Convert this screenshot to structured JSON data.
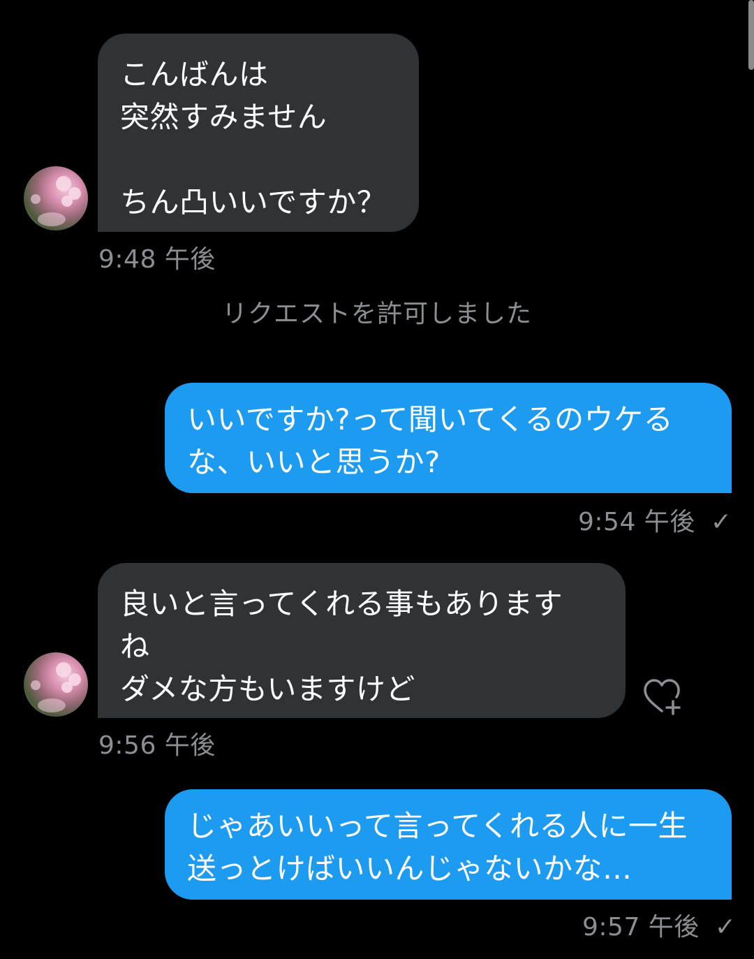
{
  "system_message": "リクエストを許可しました",
  "messages": [
    {
      "direction": "incoming",
      "text": "こんばんは\n突然すみません\n\nちん凸いいですか？",
      "time": "9:48 午後"
    },
    {
      "direction": "outgoing",
      "text": "いいですか?って聞いてくるのウケる\nな、いいと思うか?",
      "time": "9:54 午後",
      "status_icon": "checkmark-icon",
      "status_glyph": "✓"
    },
    {
      "direction": "incoming",
      "text": "良いと言ってくれる事もあります\nね\nダメな方もいますけど",
      "time": "9:56 午後",
      "action_icon": "heart-plus-icon"
    },
    {
      "direction": "outgoing",
      "text": "じゃあいいって言ってくれる人に一生\n送っとけばいいんじゃないかな…",
      "time": "9:57 午後",
      "status_icon": "checkmark-icon",
      "status_glyph": "✓"
    }
  ],
  "colors": {
    "background": "#000000",
    "incoming_bubble": "#2f3336",
    "outgoing_bubble": "#1d9bf0",
    "meta_text": "#8b8f94"
  }
}
